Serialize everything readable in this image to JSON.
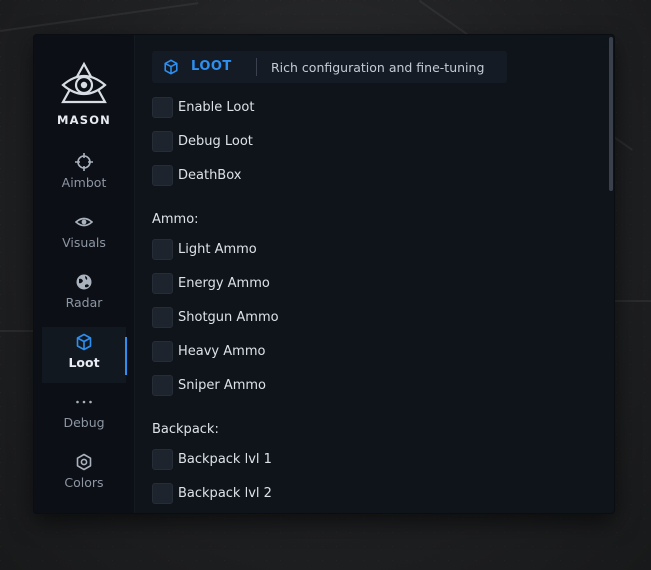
{
  "app": {
    "brand": "MASON"
  },
  "sidebar": {
    "items": [
      {
        "label": "Aimbot",
        "icon": "crosshair-icon",
        "active": false
      },
      {
        "label": "Visuals",
        "icon": "eye-icon",
        "active": false
      },
      {
        "label": "Radar",
        "icon": "globe-icon",
        "active": false
      },
      {
        "label": "Loot",
        "icon": "cube-icon",
        "active": true
      },
      {
        "label": "Debug",
        "icon": "dots-icon",
        "active": false
      },
      {
        "label": "Colors",
        "icon": "hex-gear-icon",
        "active": false
      }
    ]
  },
  "header": {
    "title": "LOOT",
    "subtitle": "Rich configuration and fine-tuning",
    "accent": "#2d8ff0"
  },
  "options": {
    "general": [
      {
        "label": "Enable Loot",
        "checked": false
      },
      {
        "label": "Debug Loot",
        "checked": false
      },
      {
        "label": "DeathBox",
        "checked": false
      }
    ],
    "ammo_title": "Ammo:",
    "ammo": [
      {
        "label": "Light Ammo",
        "checked": false
      },
      {
        "label": "Energy Ammo",
        "checked": false
      },
      {
        "label": "Shotgun Ammo",
        "checked": false
      },
      {
        "label": "Heavy Ammo",
        "checked": false
      },
      {
        "label": "Sniper Ammo",
        "checked": false
      }
    ],
    "backpack_title": "Backpack:",
    "backpack": [
      {
        "label": "Backpack lvl 1",
        "checked": false
      },
      {
        "label": "Backpack lvl 2",
        "checked": false
      }
    ]
  }
}
